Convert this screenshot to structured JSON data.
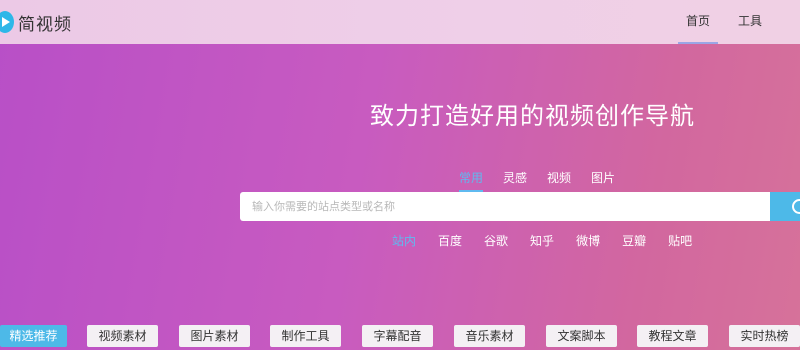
{
  "header": {
    "logo_text": "简视频",
    "nav": [
      {
        "label": "首页"
      },
      {
        "label": "工具"
      }
    ]
  },
  "hero": {
    "title": "致力打造好用的视频创作导航"
  },
  "search": {
    "tabs": [
      {
        "label": "常用"
      },
      {
        "label": "灵感"
      },
      {
        "label": "视频"
      },
      {
        "label": "图片"
      }
    ],
    "placeholder": "输入你需要的站点类型或名称",
    "engines": [
      {
        "label": "站内"
      },
      {
        "label": "百度"
      },
      {
        "label": "谷歌"
      },
      {
        "label": "知乎"
      },
      {
        "label": "微博"
      },
      {
        "label": "豆瓣"
      },
      {
        "label": "贴吧"
      }
    ]
  },
  "categories": [
    {
      "label": "精选推荐"
    },
    {
      "label": "视频素材"
    },
    {
      "label": "图片素材"
    },
    {
      "label": "制作工具"
    },
    {
      "label": "字幕配音"
    },
    {
      "label": "音乐素材"
    },
    {
      "label": "文案脚本"
    },
    {
      "label": "教程文章"
    },
    {
      "label": "实时热榜"
    }
  ],
  "colors": {
    "accent": "#4db9e8",
    "active_tab": "#5fbaf0"
  }
}
